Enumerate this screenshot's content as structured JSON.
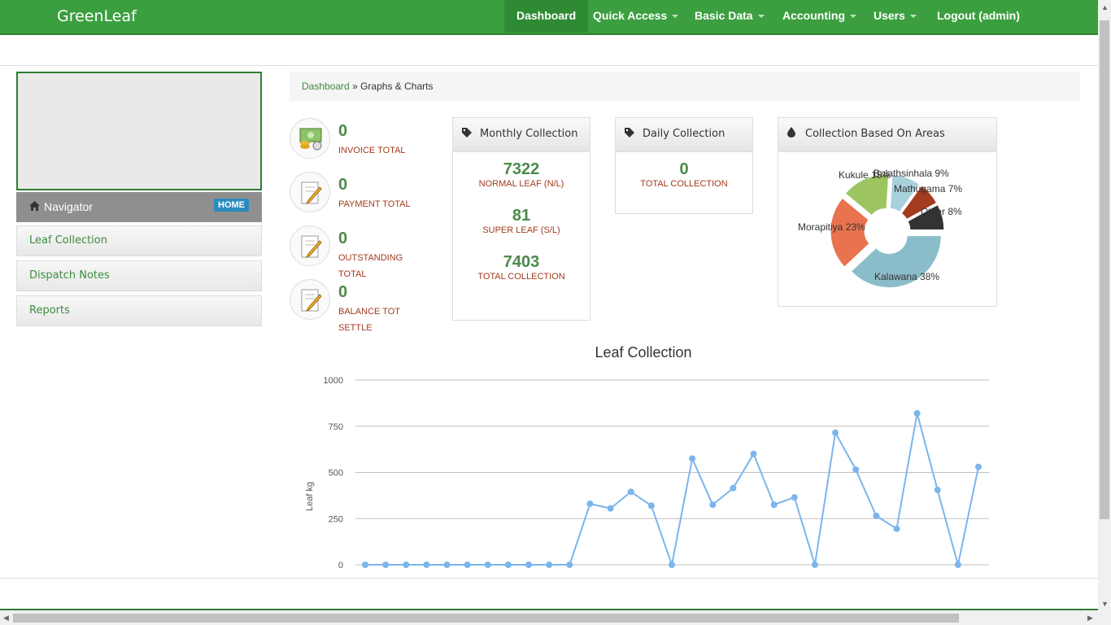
{
  "app": {
    "brand": "GreenLeaf"
  },
  "nav": {
    "items": [
      {
        "label": "Dashboard",
        "active": true,
        "dropdown": false
      },
      {
        "label": "Quick Access",
        "dropdown": true
      },
      {
        "label": "Basic Data",
        "dropdown": true
      },
      {
        "label": "Accounting",
        "dropdown": true
      },
      {
        "label": "Users",
        "dropdown": true
      },
      {
        "label": "Logout (admin)",
        "dropdown": false
      }
    ]
  },
  "sidebar": {
    "navigator_label": "Navigator",
    "home_badge": "HOME",
    "items": [
      {
        "label": "Leaf Collection"
      },
      {
        "label": "Dispatch Notes"
      },
      {
        "label": "Reports"
      }
    ]
  },
  "breadcrumb": {
    "link": "Dashboard",
    "separator": "»",
    "current": "Graphs & Charts"
  },
  "stats": [
    {
      "value": "0",
      "label": "INVOICE TOTAL",
      "icon": "money-icon"
    },
    {
      "value": "0",
      "label": "PAYMENT TOTAL",
      "icon": "pencil-note-icon"
    },
    {
      "value": "0",
      "label": "OUTSTANDING TOTAL",
      "icon": "pencil-note-icon"
    },
    {
      "value": "0",
      "label": "BALANCE TOT SETTLE",
      "icon": "pencil-note-icon"
    }
  ],
  "monthly": {
    "title": "Monthly Collection",
    "rows": [
      {
        "value": "7322",
        "label": "NORMAL LEAF (N/L)"
      },
      {
        "value": "81",
        "label": "SUPER LEAF (S/L)"
      },
      {
        "value": "7403",
        "label": "TOTAL COLLECTION"
      }
    ]
  },
  "daily": {
    "title": "Daily Collection",
    "value": "0",
    "label": "TOTAL COLLECTION"
  },
  "areas_panel": {
    "title": "Collection Based On Areas"
  },
  "colors": {
    "brand_green": "#3b9f3f",
    "value_green": "#4a8a4b",
    "label_red": "#a33b1e",
    "line_blue": "#7cb5ec"
  },
  "chart_data": [
    {
      "type": "pie",
      "title": "Collection Based On Areas",
      "slices": [
        {
          "name": "Kalawana",
          "percent": 38,
          "label": "Kalawana 38%",
          "color": "#8bbcc9"
        },
        {
          "name": "Morapitiya",
          "percent": 23,
          "label": "Morapitiya 23%",
          "color": "#e8734e"
        },
        {
          "name": "Kukule",
          "percent": 15,
          "label": "Kukule 15%",
          "color": "#9cc562"
        },
        {
          "name": "Bulathsinhala",
          "percent": 9,
          "label": "Bulathsinhala 9%",
          "color": "#a9d1dc"
        },
        {
          "name": "Mathugama",
          "percent": 7,
          "label": "Mathugama 7%",
          "color": "#a43a1e"
        },
        {
          "name": "Other",
          "percent": 8,
          "label": "Other 8%",
          "color": "#333333"
        }
      ]
    },
    {
      "type": "line",
      "title": "Leaf Collection",
      "ylabel": "Leaf kg",
      "ylim": [
        0,
        1000
      ],
      "yticks": [
        "0",
        "250",
        "500",
        "750",
        "1000"
      ],
      "grid": true,
      "values": [
        0,
        0,
        0,
        0,
        0,
        0,
        0,
        0,
        0,
        0,
        0,
        330,
        305,
        395,
        320,
        0,
        575,
        325,
        415,
        600,
        325,
        365,
        0,
        715,
        515,
        265,
        195,
        820,
        405,
        0,
        530
      ]
    }
  ]
}
